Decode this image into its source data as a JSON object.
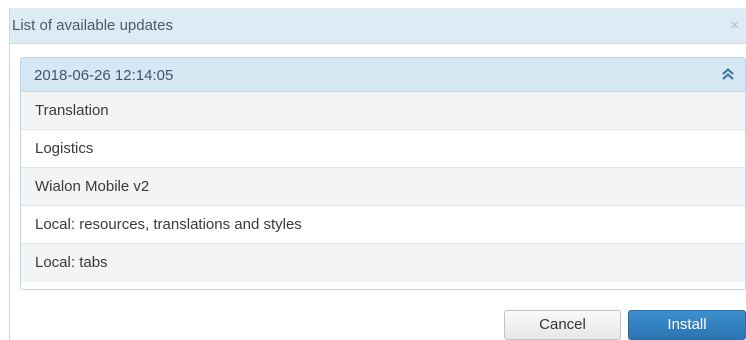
{
  "dialog": {
    "title": "List of available updates",
    "close_symbol": "×"
  },
  "panel": {
    "date": "2018-06-26 12:14:05",
    "collapse_icon": "double-chevron-up-icon",
    "items": [
      {
        "label": "Translation"
      },
      {
        "label": "Logistics"
      },
      {
        "label": "Wialon Mobile v2"
      },
      {
        "label": "Local: resources, translations and styles"
      },
      {
        "label": "Local: tabs"
      }
    ]
  },
  "buttons": {
    "cancel": "Cancel",
    "install": "Install"
  },
  "colors": {
    "titlebar_bg": "#dcebf4",
    "panel_header_bg": "#d6e8f4",
    "install_button": "#2f7cbf",
    "accent_icon": "#3d6f9a"
  }
}
